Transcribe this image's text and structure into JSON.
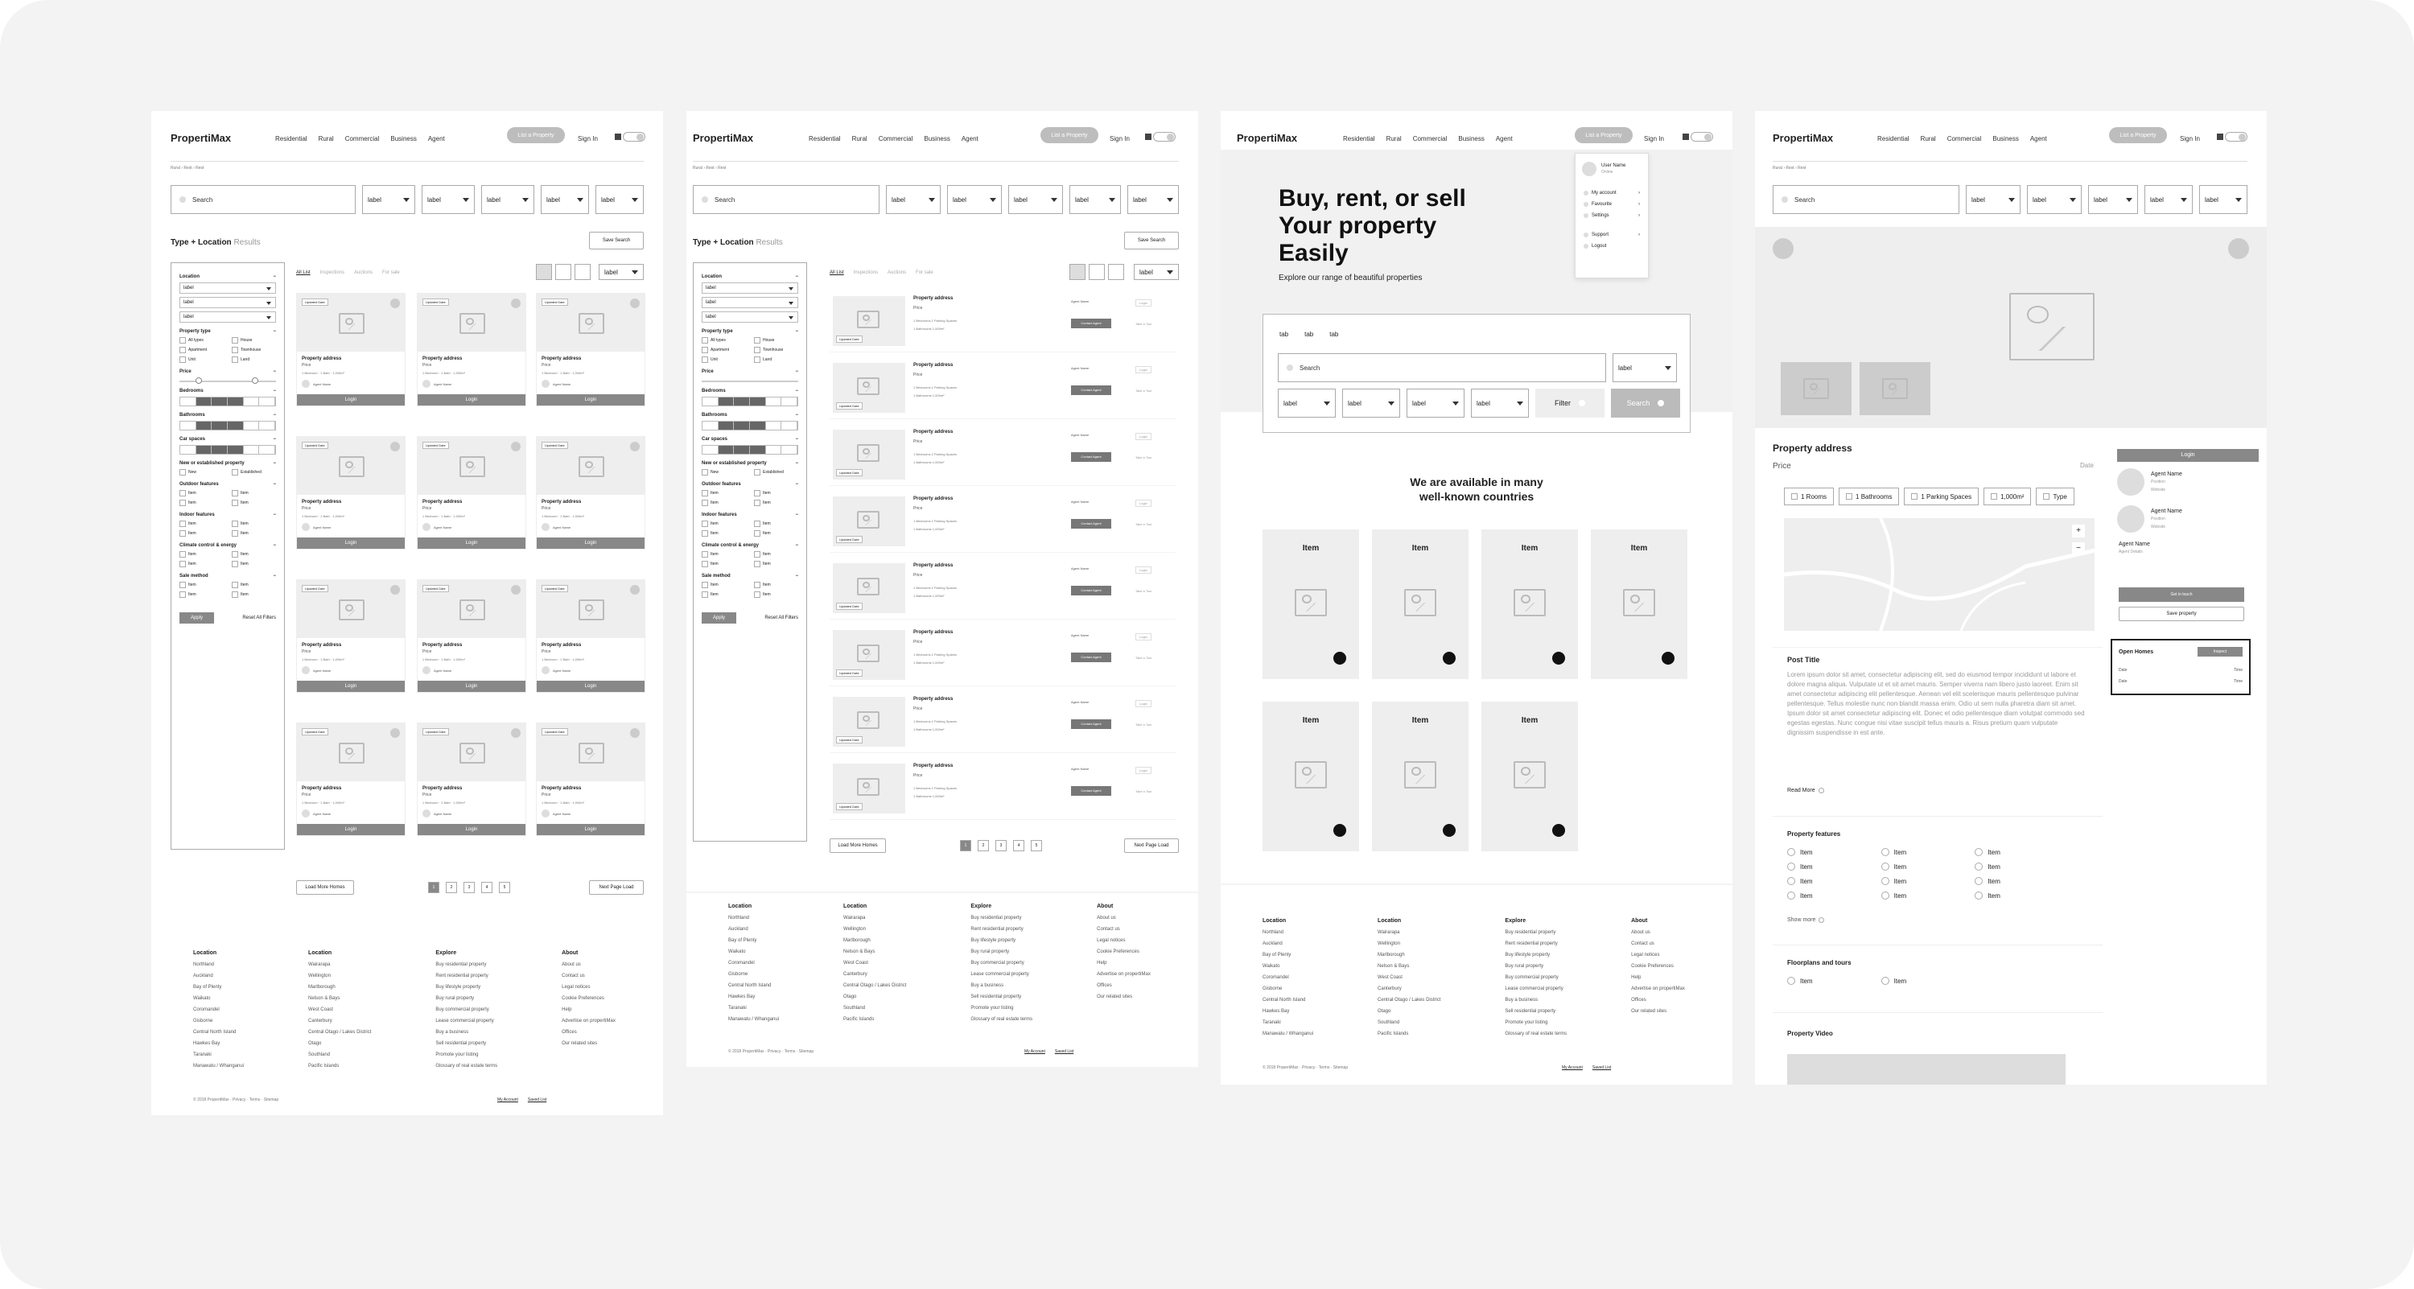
{
  "brand": "PropertiMax",
  "nav": [
    "Residential",
    "Rural",
    "Commercial",
    "Business",
    "Agent"
  ],
  "list_property": "List a Property",
  "sign_in": "Sign In",
  "crumbs": "Rural › Rest › Rest",
  "search_placeholder": "Search",
  "label": "label",
  "type_location": "Type + Location",
  "results": "Results",
  "save_search": "Save Search",
  "tabs": [
    "All List",
    "Inspections",
    "Auctions",
    "For sale"
  ],
  "filters": {
    "location": "Location",
    "property_type": "Property type",
    "types": [
      "All types",
      "House",
      "Apartment",
      "Townhouse",
      "Unit",
      "Land"
    ],
    "price": "Price",
    "bedrooms": "Bedrooms",
    "bathrooms": "Bathrooms",
    "car_spaces": "Car spaces",
    "new_established": "New or established property",
    "new_est_opts": [
      "New",
      "Established"
    ],
    "outdoor": "Outdoor features",
    "indoor": "Indoor features",
    "climate": "Climate control & energy",
    "sale_method": "Sale method",
    "item": "Item",
    "apply": "Apply",
    "reset": "Reset All Filters"
  },
  "card": {
    "tag": "Updated Date",
    "address": "Property address",
    "price": "Price",
    "meta": "1 Bedroom · 1 Bath · 1,000m²",
    "agent": "Agent Name",
    "login": "Login"
  },
  "list_row": {
    "address": "Property address",
    "price": "Price",
    "feat1": "1 Bedrooms     1 Parking Spaces",
    "feat2": "1 Bathrooms     1,000m²",
    "agent": "Agent Name",
    "contact": "Contact Agent",
    "login": "Login",
    "tour": "Take a Tour",
    "tag": "Updated Date"
  },
  "pagination": [
    "1",
    "2",
    "3",
    "4",
    "5"
  ],
  "load_more": "Load More Homes",
  "next_page": "Next Page Load",
  "footer": {
    "cols": [
      {
        "title": "Location",
        "items": [
          "Northland",
          "Auckland",
          "Bay of Plenty",
          "Waikato",
          "Coromandel",
          "Gisborne",
          "Central North Island",
          "Hawkes Bay",
          "Taranaki",
          "Manawatu / Whanganui"
        ]
      },
      {
        "title": "Location",
        "items": [
          "Wairarapa",
          "Wellington",
          "Marlborough",
          "Nelson & Bays",
          "West Coast",
          "Canterbury",
          "Central Otago / Lakes District",
          "Otago",
          "Southland",
          "Pacific Islands"
        ]
      },
      {
        "title": "Explore",
        "items": [
          "Buy residential property",
          "Rent residential property",
          "Buy lifestyle property",
          "Buy rural property",
          "Buy commercial property",
          "Lease commercial property",
          "Buy a business",
          "Sell residential property",
          "Promote your listing",
          "Glossary of real estate terms"
        ]
      },
      {
        "title": "About",
        "items": [
          "About us",
          "Contact us",
          "Legal notices",
          "Cookie Preferences",
          "Help",
          "Advertise on propertiMax",
          "Offices",
          "Our related sites"
        ]
      }
    ],
    "copyright": "© 2018 PropertiMax  ·  Privacy  ·  Terms  ·  Sitemap",
    "my_account": "My Account",
    "saved_list": "Saved List"
  },
  "home": {
    "hero_line1": "Buy, rent, or sell",
    "hero_line2": "Your property",
    "hero_line3": "Easily",
    "hero_sub": "Explore our range of beautiful properties",
    "tab": "tab",
    "filter": "Filter",
    "search": "Search",
    "avail1": "We are available in many",
    "avail2": "well-known countries",
    "item": "Item",
    "menu_user": "User Name",
    "menu_role": "Online",
    "menu_items": [
      "My account",
      "Favourite",
      "Settings",
      "Support",
      "Logout"
    ]
  },
  "detail": {
    "address": "Property address",
    "price": "Price",
    "date": "Date",
    "chips": [
      "1 Rooms",
      "1 Bathrooms",
      "1 Parking Spaces",
      "1,000m²",
      "Type"
    ],
    "login": "Login",
    "agent": "Agent Name",
    "position": "Position",
    "website": "Website",
    "agent2": "Agent Name",
    "agent_sub": "Agent Details",
    "get_in_touch": "Get in touch",
    "save_property": "Save property",
    "open_homes": "Open Homes",
    "inspect": "Inspect",
    "open_date": "Date",
    "open_time": "Time",
    "post_title": "Post Title",
    "post_body": "Lorem ipsum dolor sit amet, consectetur adipiscing elit, sed do eiusmod tempor incididunt ut labore et dolore magna aliqua. Vulputate ut et sit amet mauris. Semper viverra nam libero justo laoreet. Enim sit amet consectetur adipiscing elit pellentesque. Aenean vel elit scelerisque mauris pellentesque pulvinar pellentesque. Tellus molestie nunc non blandit massa enim. Odio ut sem nulla pharetra diam sit amet. Ipsum dolor sit amet consectetur adipiscing elit. Donec et odio pellentesque diam volutpat commodo sed egestas egestas. Nunc congue nisi vitae suscipit tellus mauris a. Risus pretium quam vulputate dignissim suspendisse in est ante.",
    "read_more": "Read More",
    "features": "Property features",
    "item": "Item",
    "show_more": "Show more",
    "floorplans": "Floorplans and tours",
    "video": "Property Video"
  }
}
